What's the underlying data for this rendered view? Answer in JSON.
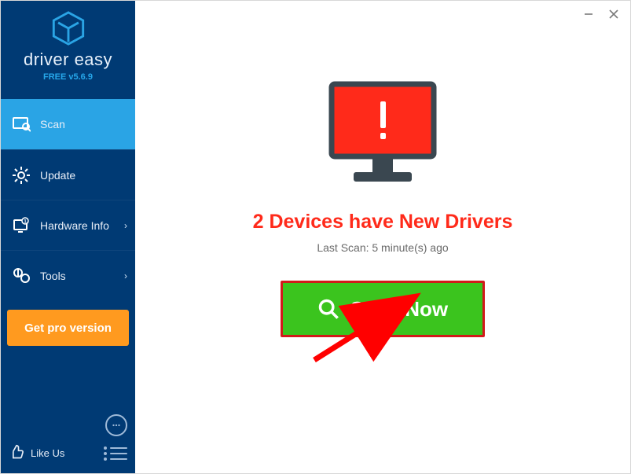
{
  "brand": {
    "name": "driver easy",
    "version": "FREE v5.6.9"
  },
  "sidebar": {
    "items": [
      {
        "label": "Scan"
      },
      {
        "label": "Update"
      },
      {
        "label": "Hardware Info"
      },
      {
        "label": "Tools"
      }
    ],
    "pro_label": "Get pro version",
    "like_label": "Like Us"
  },
  "main": {
    "headline": "2 Devices have New Drivers",
    "last_scan": "Last Scan: 5 minute(s) ago",
    "scan_button": "Scan Now"
  }
}
